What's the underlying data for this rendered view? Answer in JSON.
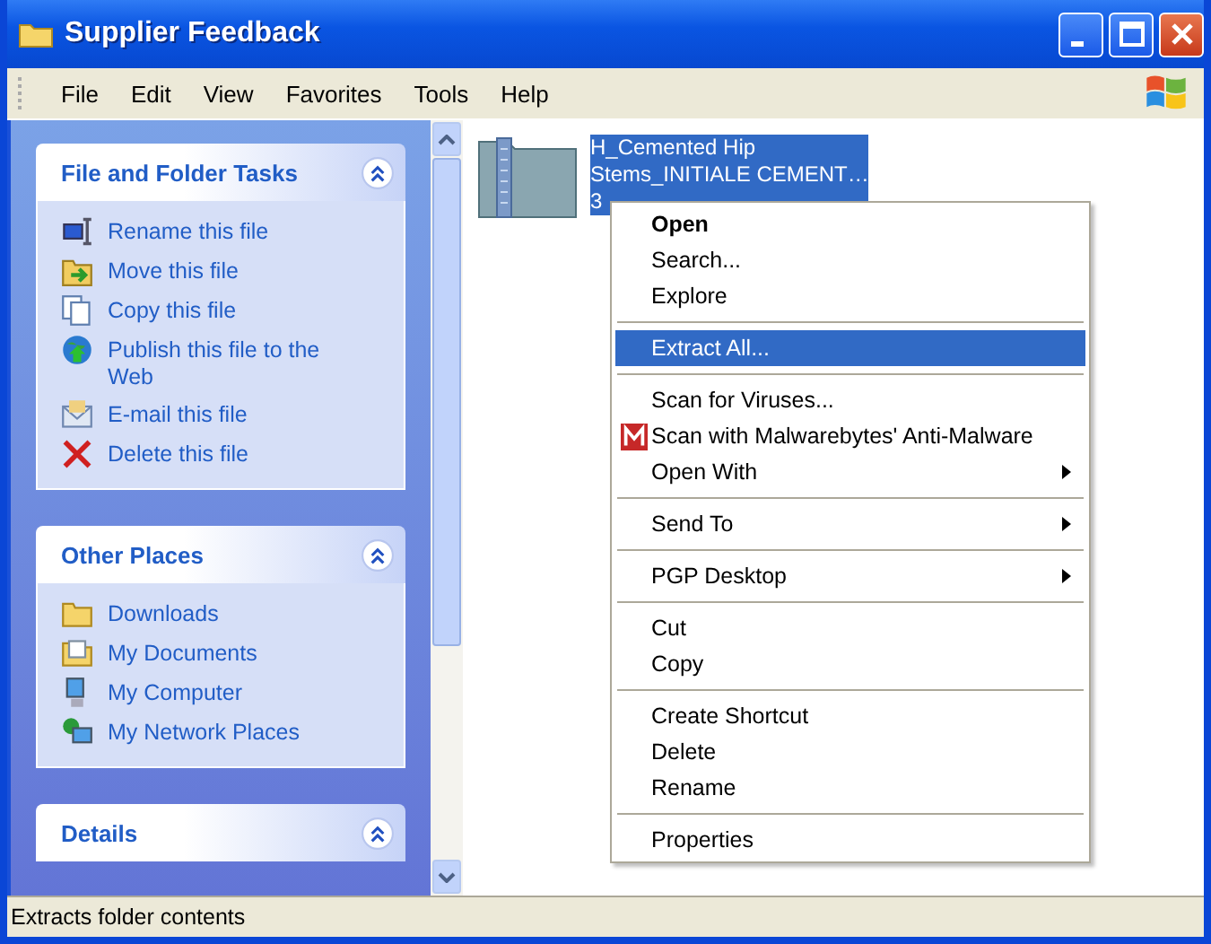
{
  "window": {
    "title": "Supplier Feedback"
  },
  "menu_bar": [
    "File",
    "Edit",
    "View",
    "Favorites",
    "Tools",
    "Help"
  ],
  "task_pane": [
    {
      "title": "File and Folder Tasks",
      "expanded": true,
      "items": [
        "Rename this file",
        "Move this file",
        "Copy this file",
        "Publish this file to the Web",
        "E-mail this file",
        "Delete this file"
      ]
    },
    {
      "title": "Other Places",
      "expanded": true,
      "items": [
        "Downloads",
        "My Documents",
        "My Computer",
        "My Network Places"
      ]
    },
    {
      "title": "Details",
      "expanded": true
    }
  ],
  "file": {
    "lines": [
      "H_Cemented Hip",
      "Stems_INITIALE CEMENT…",
      "3"
    ],
    "selected": true
  },
  "context_menu": [
    {
      "kind": "item",
      "label": "Open",
      "bold": true,
      "selected": false,
      "submenu": false
    },
    {
      "kind": "item",
      "label": "Search...",
      "bold": false,
      "selected": false,
      "submenu": false
    },
    {
      "kind": "item",
      "label": "Explore",
      "bold": false,
      "selected": false,
      "submenu": false
    },
    {
      "kind": "separator"
    },
    {
      "kind": "item",
      "label": "Extract All...",
      "bold": false,
      "selected": true,
      "submenu": false
    },
    {
      "kind": "separator"
    },
    {
      "kind": "item",
      "label": "Scan for Viruses...",
      "bold": false,
      "selected": false,
      "submenu": false
    },
    {
      "kind": "icon_item",
      "label": "Scan with Malwarebytes' Anti-Malware",
      "bold": false,
      "selected": false,
      "submenu": false
    },
    {
      "kind": "item",
      "label": "Open With",
      "bold": false,
      "selected": false,
      "submenu": true
    },
    {
      "kind": "separator"
    },
    {
      "kind": "item",
      "label": "Send To",
      "bold": false,
      "selected": false,
      "submenu": true
    },
    {
      "kind": "separator"
    },
    {
      "kind": "item",
      "label": "PGP Desktop",
      "bold": false,
      "selected": false,
      "submenu": true
    },
    {
      "kind": "separator"
    },
    {
      "kind": "item",
      "label": "Cut",
      "bold": false,
      "selected": false,
      "submenu": false
    },
    {
      "kind": "item",
      "label": "Copy",
      "bold": false,
      "selected": false,
      "submenu": false
    },
    {
      "kind": "separator"
    },
    {
      "kind": "item",
      "label": "Create Shortcut",
      "bold": false,
      "selected": false,
      "submenu": false
    },
    {
      "kind": "item",
      "label": "Delete",
      "bold": false,
      "selected": false,
      "submenu": false
    },
    {
      "kind": "item",
      "label": "Rename",
      "bold": false,
      "selected": false,
      "submenu": false
    },
    {
      "kind": "separator"
    },
    {
      "kind": "item",
      "label": "Properties",
      "bold": false,
      "selected": false,
      "submenu": false
    }
  ],
  "status_bar": "Extracts folder contents"
}
